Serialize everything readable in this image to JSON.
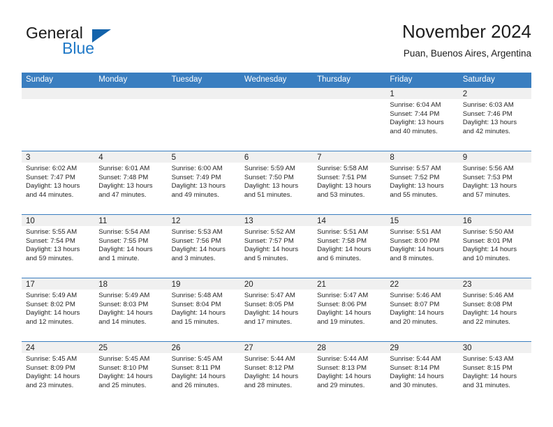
{
  "brand": {
    "word_one": "General",
    "word_two": "Blue",
    "triangle_color": "#1363ab",
    "blue_color": "#2079c7"
  },
  "header": {
    "month_title": "November 2024",
    "location": "Puan, Buenos Aires, Argentina"
  },
  "calendar": {
    "header_color": "#3a7ec0",
    "daynum_bg": "#f0f0f0",
    "weekdays": [
      "Sunday",
      "Monday",
      "Tuesday",
      "Wednesday",
      "Thursday",
      "Friday",
      "Saturday"
    ],
    "weeks": [
      [
        {
          "empty": true
        },
        {
          "empty": true
        },
        {
          "empty": true
        },
        {
          "empty": true
        },
        {
          "empty": true
        },
        {
          "day": "1",
          "sunrise": "Sunrise: 6:04 AM",
          "sunset": "Sunset: 7:44 PM",
          "daylight_1": "Daylight: 13 hours",
          "daylight_2": "and 40 minutes."
        },
        {
          "day": "2",
          "sunrise": "Sunrise: 6:03 AM",
          "sunset": "Sunset: 7:46 PM",
          "daylight_1": "Daylight: 13 hours",
          "daylight_2": "and 42 minutes."
        }
      ],
      [
        {
          "day": "3",
          "sunrise": "Sunrise: 6:02 AM",
          "sunset": "Sunset: 7:47 PM",
          "daylight_1": "Daylight: 13 hours",
          "daylight_2": "and 44 minutes."
        },
        {
          "day": "4",
          "sunrise": "Sunrise: 6:01 AM",
          "sunset": "Sunset: 7:48 PM",
          "daylight_1": "Daylight: 13 hours",
          "daylight_2": "and 47 minutes."
        },
        {
          "day": "5",
          "sunrise": "Sunrise: 6:00 AM",
          "sunset": "Sunset: 7:49 PM",
          "daylight_1": "Daylight: 13 hours",
          "daylight_2": "and 49 minutes."
        },
        {
          "day": "6",
          "sunrise": "Sunrise: 5:59 AM",
          "sunset": "Sunset: 7:50 PM",
          "daylight_1": "Daylight: 13 hours",
          "daylight_2": "and 51 minutes."
        },
        {
          "day": "7",
          "sunrise": "Sunrise: 5:58 AM",
          "sunset": "Sunset: 7:51 PM",
          "daylight_1": "Daylight: 13 hours",
          "daylight_2": "and 53 minutes."
        },
        {
          "day": "8",
          "sunrise": "Sunrise: 5:57 AM",
          "sunset": "Sunset: 7:52 PM",
          "daylight_1": "Daylight: 13 hours",
          "daylight_2": "and 55 minutes."
        },
        {
          "day": "9",
          "sunrise": "Sunrise: 5:56 AM",
          "sunset": "Sunset: 7:53 PM",
          "daylight_1": "Daylight: 13 hours",
          "daylight_2": "and 57 minutes."
        }
      ],
      [
        {
          "day": "10",
          "sunrise": "Sunrise: 5:55 AM",
          "sunset": "Sunset: 7:54 PM",
          "daylight_1": "Daylight: 13 hours",
          "daylight_2": "and 59 minutes."
        },
        {
          "day": "11",
          "sunrise": "Sunrise: 5:54 AM",
          "sunset": "Sunset: 7:55 PM",
          "daylight_1": "Daylight: 14 hours",
          "daylight_2": "and 1 minute."
        },
        {
          "day": "12",
          "sunrise": "Sunrise: 5:53 AM",
          "sunset": "Sunset: 7:56 PM",
          "daylight_1": "Daylight: 14 hours",
          "daylight_2": "and 3 minutes."
        },
        {
          "day": "13",
          "sunrise": "Sunrise: 5:52 AM",
          "sunset": "Sunset: 7:57 PM",
          "daylight_1": "Daylight: 14 hours",
          "daylight_2": "and 5 minutes."
        },
        {
          "day": "14",
          "sunrise": "Sunrise: 5:51 AM",
          "sunset": "Sunset: 7:58 PM",
          "daylight_1": "Daylight: 14 hours",
          "daylight_2": "and 6 minutes."
        },
        {
          "day": "15",
          "sunrise": "Sunrise: 5:51 AM",
          "sunset": "Sunset: 8:00 PM",
          "daylight_1": "Daylight: 14 hours",
          "daylight_2": "and 8 minutes."
        },
        {
          "day": "16",
          "sunrise": "Sunrise: 5:50 AM",
          "sunset": "Sunset: 8:01 PM",
          "daylight_1": "Daylight: 14 hours",
          "daylight_2": "and 10 minutes."
        }
      ],
      [
        {
          "day": "17",
          "sunrise": "Sunrise: 5:49 AM",
          "sunset": "Sunset: 8:02 PM",
          "daylight_1": "Daylight: 14 hours",
          "daylight_2": "and 12 minutes."
        },
        {
          "day": "18",
          "sunrise": "Sunrise: 5:49 AM",
          "sunset": "Sunset: 8:03 PM",
          "daylight_1": "Daylight: 14 hours",
          "daylight_2": "and 14 minutes."
        },
        {
          "day": "19",
          "sunrise": "Sunrise: 5:48 AM",
          "sunset": "Sunset: 8:04 PM",
          "daylight_1": "Daylight: 14 hours",
          "daylight_2": "and 15 minutes."
        },
        {
          "day": "20",
          "sunrise": "Sunrise: 5:47 AM",
          "sunset": "Sunset: 8:05 PM",
          "daylight_1": "Daylight: 14 hours",
          "daylight_2": "and 17 minutes."
        },
        {
          "day": "21",
          "sunrise": "Sunrise: 5:47 AM",
          "sunset": "Sunset: 8:06 PM",
          "daylight_1": "Daylight: 14 hours",
          "daylight_2": "and 19 minutes."
        },
        {
          "day": "22",
          "sunrise": "Sunrise: 5:46 AM",
          "sunset": "Sunset: 8:07 PM",
          "daylight_1": "Daylight: 14 hours",
          "daylight_2": "and 20 minutes."
        },
        {
          "day": "23",
          "sunrise": "Sunrise: 5:46 AM",
          "sunset": "Sunset: 8:08 PM",
          "daylight_1": "Daylight: 14 hours",
          "daylight_2": "and 22 minutes."
        }
      ],
      [
        {
          "day": "24",
          "sunrise": "Sunrise: 5:45 AM",
          "sunset": "Sunset: 8:09 PM",
          "daylight_1": "Daylight: 14 hours",
          "daylight_2": "and 23 minutes."
        },
        {
          "day": "25",
          "sunrise": "Sunrise: 5:45 AM",
          "sunset": "Sunset: 8:10 PM",
          "daylight_1": "Daylight: 14 hours",
          "daylight_2": "and 25 minutes."
        },
        {
          "day": "26",
          "sunrise": "Sunrise: 5:45 AM",
          "sunset": "Sunset: 8:11 PM",
          "daylight_1": "Daylight: 14 hours",
          "daylight_2": "and 26 minutes."
        },
        {
          "day": "27",
          "sunrise": "Sunrise: 5:44 AM",
          "sunset": "Sunset: 8:12 PM",
          "daylight_1": "Daylight: 14 hours",
          "daylight_2": "and 28 minutes."
        },
        {
          "day": "28",
          "sunrise": "Sunrise: 5:44 AM",
          "sunset": "Sunset: 8:13 PM",
          "daylight_1": "Daylight: 14 hours",
          "daylight_2": "and 29 minutes."
        },
        {
          "day": "29",
          "sunrise": "Sunrise: 5:44 AM",
          "sunset": "Sunset: 8:14 PM",
          "daylight_1": "Daylight: 14 hours",
          "daylight_2": "and 30 minutes."
        },
        {
          "day": "30",
          "sunrise": "Sunrise: 5:43 AM",
          "sunset": "Sunset: 8:15 PM",
          "daylight_1": "Daylight: 14 hours",
          "daylight_2": "and 31 minutes."
        }
      ]
    ]
  }
}
